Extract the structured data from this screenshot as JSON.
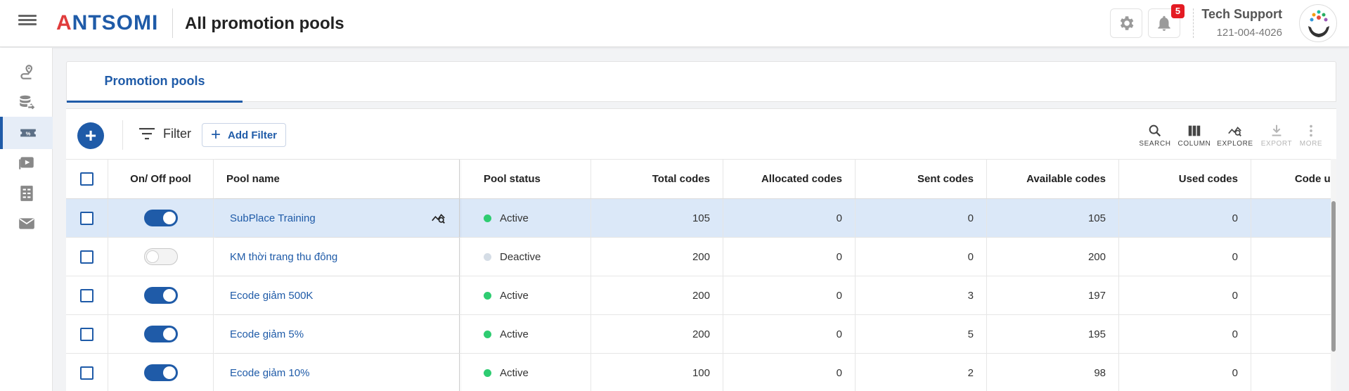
{
  "header": {
    "logo": {
      "prefix": "A",
      "rest": "NTSOMI"
    },
    "title": "All promotion pools",
    "notification_count": "5",
    "user_name": "Tech Support",
    "user_phone": "121-004-4026"
  },
  "sidebar": {
    "items": [
      {
        "icon": "journey-icon"
      },
      {
        "icon": "data-export-icon"
      },
      {
        "icon": "ticket-icon",
        "active": true
      },
      {
        "icon": "media-icon"
      },
      {
        "icon": "report-icon"
      },
      {
        "icon": "mail-icon"
      }
    ]
  },
  "tabs": [
    {
      "label": "Promotion pools",
      "active": true
    }
  ],
  "toolbar": {
    "filter_label": "Filter",
    "add_filter_label": "Add Filter",
    "actions": [
      {
        "label": "SEARCH",
        "icon": "search-icon",
        "disabled": false
      },
      {
        "label": "COLUMN",
        "icon": "column-icon",
        "disabled": false
      },
      {
        "label": "EXPLORE",
        "icon": "explore-icon",
        "disabled": false
      },
      {
        "label": "EXPORT",
        "icon": "export-icon",
        "disabled": true
      },
      {
        "label": "MORE",
        "icon": "more-icon",
        "disabled": true
      }
    ]
  },
  "table": {
    "columns": [
      "On/ Off pool",
      "Pool name",
      "Pool status",
      "Total codes",
      "Allocated codes",
      "Sent codes",
      "Available codes",
      "Used codes",
      "Code us"
    ],
    "rows": [
      {
        "on": true,
        "name": "SubPlace Training",
        "status": "Active",
        "total": "105",
        "allocated": "0",
        "sent": "0",
        "available": "105",
        "used": "0",
        "selected": true
      },
      {
        "on": false,
        "name": "KM thời trang thu đông",
        "status": "Deactive",
        "total": "200",
        "allocated": "0",
        "sent": "0",
        "available": "200",
        "used": "0",
        "selected": false
      },
      {
        "on": true,
        "name": "Ecode giảm 500K",
        "status": "Active",
        "total": "200",
        "allocated": "0",
        "sent": "3",
        "available": "197",
        "used": "0",
        "selected": false
      },
      {
        "on": true,
        "name": "Ecode giảm 5%",
        "status": "Active",
        "total": "200",
        "allocated": "0",
        "sent": "5",
        "available": "195",
        "used": "0",
        "selected": false
      },
      {
        "on": true,
        "name": "Ecode giảm 10%",
        "status": "Active",
        "total": "100",
        "allocated": "0",
        "sent": "2",
        "available": "98",
        "used": "0",
        "selected": false
      }
    ]
  },
  "colors": {
    "brand": "#1f5ba8",
    "active_dot": "#2ecc71",
    "deactive_dot": "#d5dde6",
    "badge": "#e41b23"
  }
}
